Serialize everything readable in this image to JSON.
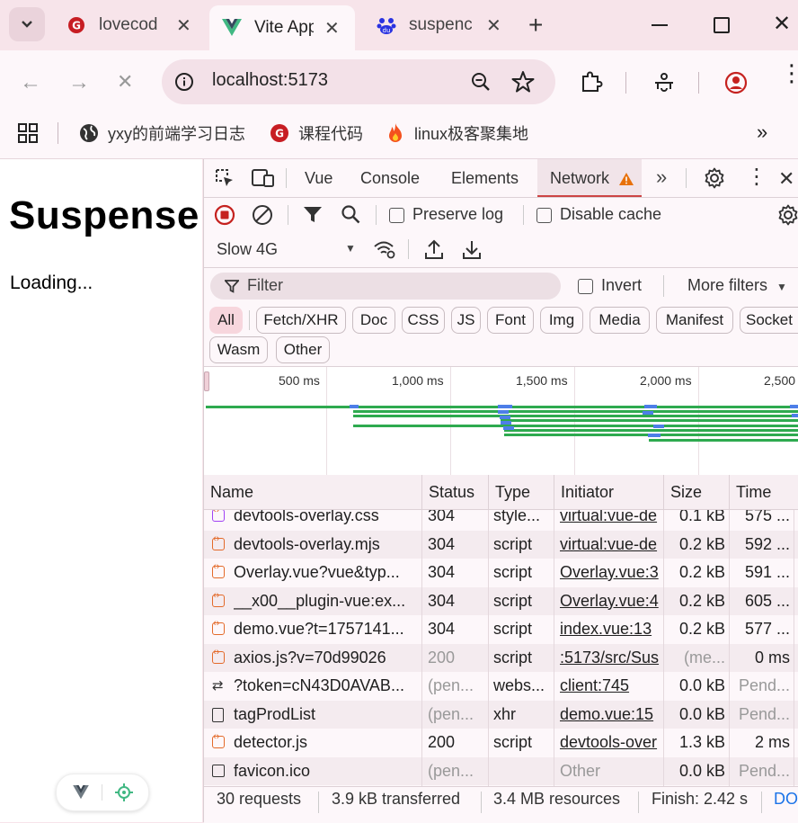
{
  "tabs": [
    {
      "title": "lovecod",
      "icon": "gitee-icon"
    },
    {
      "title": "Vite App",
      "icon": "vue-icon"
    },
    {
      "title": "suspenc",
      "icon": "baidu-icon"
    }
  ],
  "toolbar": {
    "url": "localhost:5173"
  },
  "bookmarks": [
    {
      "label": "yxy的前端学习日志",
      "icon": "globe-icon"
    },
    {
      "label": "课程代码",
      "icon": "gitee-icon"
    },
    {
      "label": "linux极客聚集地",
      "icon": "fire-icon"
    }
  ],
  "page": {
    "title": "Suspense",
    "status": "Loading..."
  },
  "devtools": {
    "tabs": [
      "Vue",
      "Console",
      "Elements",
      "Network"
    ],
    "preserve_log": "Preserve log",
    "disable_cache": "Disable cache",
    "throttle": "Slow 4G",
    "filter_placeholder": "Filter",
    "invert": "Invert",
    "more_filters": "More filters",
    "type_filters": [
      "All",
      "Fetch/XHR",
      "Doc",
      "CSS",
      "JS",
      "Font",
      "Img",
      "Media",
      "Manifest",
      "Socket",
      "Wasm",
      "Other"
    ],
    "timeline_ticks": [
      "500 ms",
      "1,000 ms",
      "1,500 ms",
      "2,000 ms",
      "2,500"
    ],
    "columns": [
      "Name",
      "Status",
      "Type",
      "Initiator",
      "Size",
      "Time"
    ],
    "rows": [
      {
        "name": "devtools-overlay.css",
        "status": "304",
        "type": "style...",
        "initiator": "virtual:vue-de",
        "size": "0.1 kB",
        "time": "575 ...",
        "icon": "css-file-icon"
      },
      {
        "name": "devtools-overlay.mjs",
        "status": "304",
        "type": "script",
        "initiator": "virtual:vue-de",
        "size": "0.2 kB",
        "time": "592 ...",
        "icon": "script-file-icon"
      },
      {
        "name": "Overlay.vue?vue&typ...",
        "status": "304",
        "type": "script",
        "initiator": "Overlay.vue:3",
        "size": "0.2 kB",
        "time": "591 ...",
        "icon": "script-file-icon"
      },
      {
        "name": "__x00__plugin-vue:ex...",
        "status": "304",
        "type": "script",
        "initiator": "Overlay.vue:4",
        "size": "0.2 kB",
        "time": "605 ...",
        "icon": "script-file-icon"
      },
      {
        "name": "demo.vue?t=1757141...",
        "status": "304",
        "type": "script",
        "initiator": "index.vue:13",
        "size": "0.2 kB",
        "time": "577 ...",
        "icon": "script-file-icon"
      },
      {
        "name": "axios.js?v=70d99026",
        "status": "200",
        "type": "script",
        "initiator": ":5173/src/Sus",
        "size": "(me...",
        "time": "0 ms",
        "icon": "script-file-icon"
      },
      {
        "name": "?token=cN43D0AVAB...",
        "status": "(pen...",
        "type": "webs...",
        "initiator": "client:745",
        "size": "0.0 kB",
        "time": "Pend...",
        "icon": "websocket-icon"
      },
      {
        "name": "tagProdList",
        "status": "(pen...",
        "type": "xhr",
        "initiator": "demo.vue:15",
        "size": "0.0 kB",
        "time": "Pend...",
        "icon": "document-icon"
      },
      {
        "name": "detector.js",
        "status": "200",
        "type": "script",
        "initiator": "devtools-over",
        "size": "1.3 kB",
        "time": "2 ms",
        "icon": "script-file-icon"
      },
      {
        "name": "favicon.ico",
        "status": "(pen...",
        "type": "",
        "initiator": "Other",
        "size": "0.0 kB",
        "time": "Pend...",
        "icon": "image-file-icon"
      }
    ],
    "footer": [
      "30 requests",
      "3.9 kB transferred",
      "3.4 MB resources",
      "Finish: 2.42 s",
      "DO"
    ]
  },
  "colors": {
    "accent": "#c5221f",
    "waiting": "#2eaa4f",
    "download": "#4d7ee8",
    "chrome_bg": "#f7e4ea"
  }
}
